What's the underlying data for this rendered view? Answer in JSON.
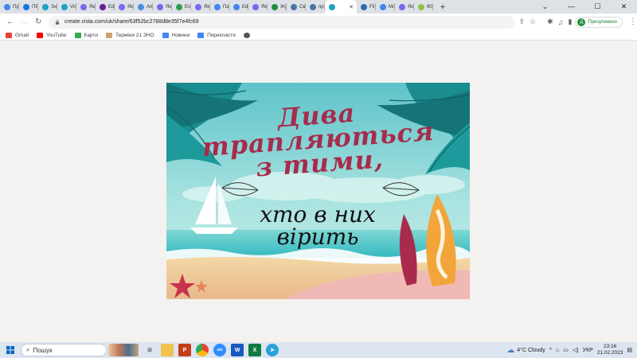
{
  "tabs": [
    {
      "label": "Пр",
      "icon": "google-icon",
      "color": "#4285f4"
    },
    {
      "label": "ПР",
      "icon": "docs-icon",
      "color": "#1a73e8"
    },
    {
      "label": "Зн",
      "icon": "vista-icon",
      "color": "#1ca3c7"
    },
    {
      "label": "Vis",
      "icon": "vista-icon",
      "color": "#1ca3c7"
    },
    {
      "label": "Як",
      "icon": "gear-icon",
      "color": "#7b68ee"
    },
    {
      "label": "Edi",
      "icon": "edit-icon",
      "color": "#6a1b9a"
    },
    {
      "label": "Як",
      "icon": "gear-icon",
      "color": "#7b68ee"
    },
    {
      "label": "Ап",
      "icon": "image-icon",
      "color": "#4a90d9"
    },
    {
      "label": "Як",
      "icon": "gear-icon",
      "color": "#7b68ee"
    },
    {
      "label": "Evi",
      "icon": "evi-icon",
      "color": "#2e9e4f"
    },
    {
      "label": "Як",
      "icon": "gear-icon",
      "color": "#7b68ee"
    },
    {
      "label": "Па",
      "icon": "google-icon",
      "color": "#4285f4"
    },
    {
      "label": "Edi",
      "icon": "google-icon",
      "color": "#4285f4"
    },
    {
      "label": "Як",
      "icon": "gear-icon",
      "color": "#7b68ee"
    },
    {
      "label": "Жу",
      "icon": "plus-icon",
      "color": "#1e8e3e"
    },
    {
      "label": "Св",
      "icon": "vk-icon",
      "color": "#4a76a8"
    },
    {
      "label": "пр",
      "icon": "vk-icon",
      "color": "#4a76a8"
    },
    {
      "label": "",
      "icon": "vista-icon",
      "color": "#1ca3c7",
      "active": true
    },
    {
      "label": "Fli",
      "icon": "flip-icon",
      "color": "#2b6cb0"
    },
    {
      "label": "Mo",
      "icon": "google-icon",
      "color": "#4285f4"
    },
    {
      "label": "Як",
      "icon": "gear-icon",
      "color": "#7b68ee"
    },
    {
      "label": "60",
      "icon": "eye-icon",
      "color": "#8bc34a"
    }
  ],
  "window_controls": {
    "minimize": "⌄",
    "min2": "—",
    "max": "☐",
    "close": "✕"
  },
  "toolbar": {
    "url": "create.vista.com/uk/share/63f52bc2788d8e35f7e4fc69",
    "profile_initial": "Д",
    "profile_label": "Призупинено"
  },
  "bookmarks": [
    {
      "label": "Gmail",
      "icon": "gmail-icon",
      "color": "#ea4335"
    },
    {
      "label": "YouTube",
      "icon": "youtube-icon",
      "color": "#ff0000"
    },
    {
      "label": "Карти",
      "icon": "maps-icon",
      "color": "#34a853"
    },
    {
      "label": "Терміни 21 ЗНО",
      "icon": "folder-icon",
      "color": "#c9a66b"
    },
    {
      "label": "Новини",
      "icon": "news-icon",
      "color": "#4285f4"
    },
    {
      "label": "Перекласти",
      "icon": "translate-icon",
      "color": "#4285f4"
    },
    {
      "label": "",
      "icon": "globe-icon",
      "color": "#555555"
    }
  ],
  "postcard": {
    "line1": "Дива",
    "line2": "трапляються",
    "line3": "з тими,",
    "line4": "хто в них",
    "line5": "вірить"
  },
  "taskbar": {
    "search_label": "Пошук",
    "weather": "4°C  Cloudy",
    "lang": "УКР",
    "time": "23:16",
    "date": "21.02.2023"
  }
}
